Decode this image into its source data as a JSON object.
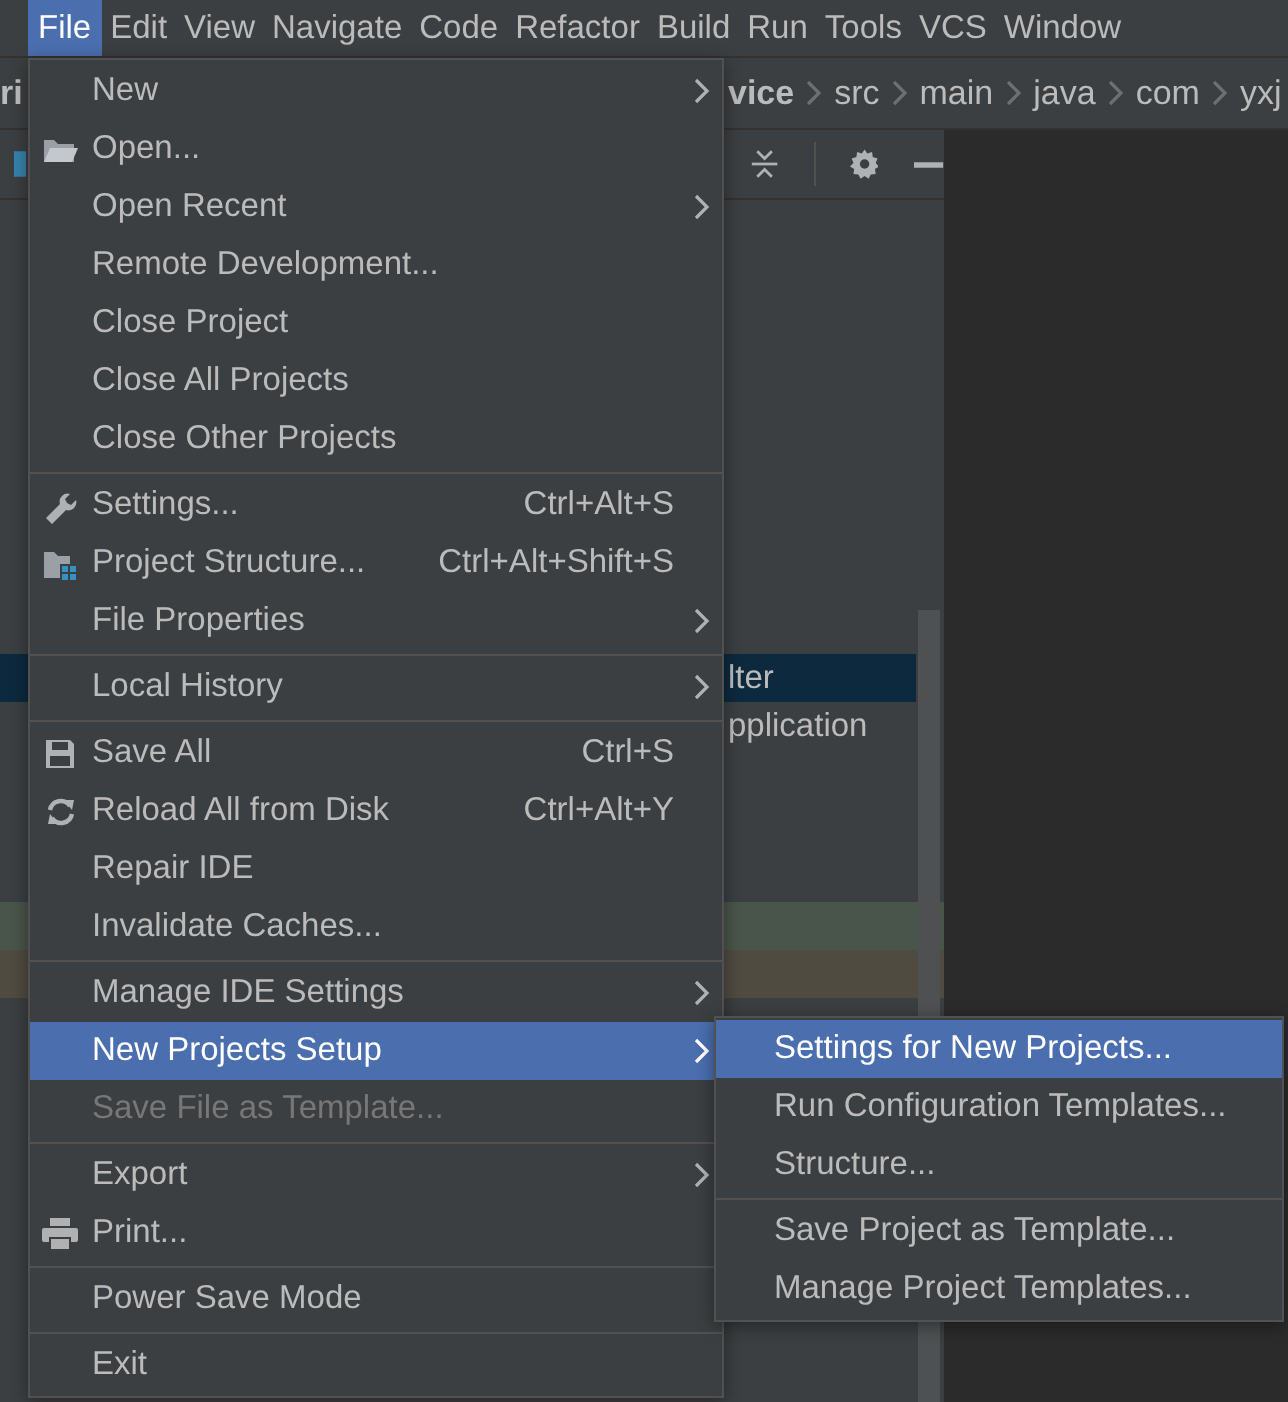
{
  "menu_bar": [
    {
      "label": "File",
      "selected": true
    },
    {
      "label": "Edit",
      "selected": false
    },
    {
      "label": "View",
      "selected": false
    },
    {
      "label": "Navigate",
      "selected": false
    },
    {
      "label": "Code",
      "selected": false
    },
    {
      "label": "Refactor",
      "selected": false
    },
    {
      "label": "Build",
      "selected": false
    },
    {
      "label": "Run",
      "selected": false
    },
    {
      "label": "Tools",
      "selected": false
    },
    {
      "label": "VCS",
      "selected": false
    },
    {
      "label": "Window",
      "selected": false
    }
  ],
  "breadcrumb": {
    "partial_title": "ri",
    "crumbs": [
      "vice",
      "src",
      "main",
      "java",
      "com",
      "yxj"
    ]
  },
  "tree_rows": [
    {
      "text": "lter",
      "selected": true
    },
    {
      "text": "pplication",
      "selected": false
    }
  ],
  "highlight_rows": [
    {
      "color": "#49544a"
    },
    {
      "color": "#4f4b41"
    }
  ],
  "file_menu": [
    {
      "kind": "item",
      "label": "New",
      "submenu": true,
      "selected": false,
      "disabled": false
    },
    {
      "kind": "item",
      "label": "Open...",
      "submenu": false,
      "selected": false,
      "disabled": false
    },
    {
      "kind": "item",
      "label": "Open Recent",
      "submenu": true,
      "selected": false,
      "disabled": false
    },
    {
      "kind": "item",
      "label": "Remote Development...",
      "submenu": false,
      "selected": false,
      "disabled": false
    },
    {
      "kind": "item",
      "label": "Close Project",
      "submenu": false,
      "selected": false,
      "disabled": false
    },
    {
      "kind": "item",
      "label": "Close All Projects",
      "submenu": false,
      "selected": false,
      "disabled": false
    },
    {
      "kind": "item",
      "label": "Close Other Projects",
      "submenu": false,
      "selected": false,
      "disabled": false
    },
    {
      "kind": "separator"
    },
    {
      "kind": "item",
      "label": "Settings...",
      "shortcut": "Ctrl+Alt+S",
      "submenu": false,
      "selected": false,
      "disabled": false
    },
    {
      "kind": "item",
      "label": "Project Structure...",
      "shortcut": "Ctrl+Alt+Shift+S",
      "submenu": false,
      "selected": false,
      "disabled": false
    },
    {
      "kind": "item",
      "label": "File Properties",
      "submenu": true,
      "selected": false,
      "disabled": false
    },
    {
      "kind": "separator"
    },
    {
      "kind": "item",
      "label": "Local History",
      "submenu": true,
      "selected": false,
      "disabled": false
    },
    {
      "kind": "separator"
    },
    {
      "kind": "item",
      "label": "Save All",
      "shortcut": "Ctrl+S",
      "submenu": false,
      "selected": false,
      "disabled": false
    },
    {
      "kind": "item",
      "label": "Reload All from Disk",
      "shortcut": "Ctrl+Alt+Y",
      "submenu": false,
      "selected": false,
      "disabled": false
    },
    {
      "kind": "item",
      "label": "Repair IDE",
      "submenu": false,
      "selected": false,
      "disabled": false
    },
    {
      "kind": "item",
      "label": "Invalidate Caches...",
      "submenu": false,
      "selected": false,
      "disabled": false
    },
    {
      "kind": "separator"
    },
    {
      "kind": "item",
      "label": "Manage IDE Settings",
      "submenu": true,
      "selected": false,
      "disabled": false
    },
    {
      "kind": "item",
      "label": "New Projects Setup",
      "submenu": true,
      "selected": true,
      "disabled": false
    },
    {
      "kind": "item",
      "label": "Save File as Template...",
      "submenu": false,
      "selected": false,
      "disabled": true
    },
    {
      "kind": "separator"
    },
    {
      "kind": "item",
      "label": "Export",
      "submenu": true,
      "selected": false,
      "disabled": false
    },
    {
      "kind": "item",
      "label": "Print...",
      "submenu": false,
      "selected": false,
      "disabled": false
    },
    {
      "kind": "separator"
    },
    {
      "kind": "item",
      "label": "Power Save Mode",
      "submenu": false,
      "selected": false,
      "disabled": false
    },
    {
      "kind": "separator"
    },
    {
      "kind": "item",
      "label": "Exit",
      "submenu": false,
      "selected": false,
      "disabled": false
    }
  ],
  "submenu": [
    {
      "kind": "item",
      "label": "Settings for New Projects...",
      "selected": true
    },
    {
      "kind": "item",
      "label": "Run Configuration Templates...",
      "selected": false
    },
    {
      "kind": "item",
      "label": "Structure...",
      "selected": false
    },
    {
      "kind": "separator"
    },
    {
      "kind": "item",
      "label": "Save Project as Template...",
      "selected": false
    },
    {
      "kind": "item",
      "label": "Manage Project Templates...",
      "selected": false
    }
  ]
}
